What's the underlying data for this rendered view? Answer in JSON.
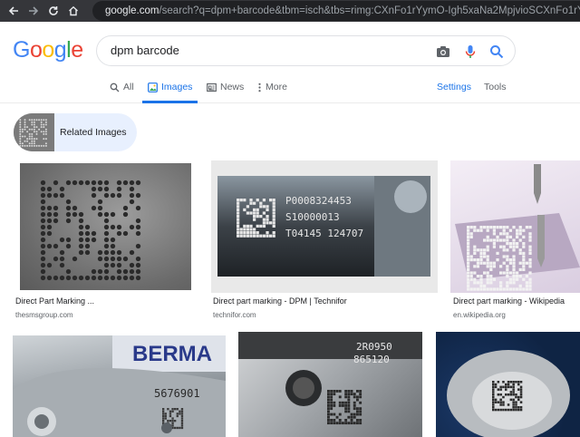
{
  "browser": {
    "url_host": "google.com",
    "url_rest": "/search?q=dpm+barcode&tbm=isch&tbs=rimg:CXnFo1rYymO-Igh5xaNa2MpjvioSCXnFo1rYymO-EVQF"
  },
  "logo": {
    "letters": [
      "G",
      "o",
      "o",
      "g",
      "l",
      "e"
    ],
    "colors": [
      "#4285f4",
      "#ea4335",
      "#fbbc05",
      "#4285f4",
      "#34a853",
      "#ea4335"
    ]
  },
  "search": {
    "query": "dpm barcode"
  },
  "tabs": {
    "all": "All",
    "images": "Images",
    "news": "News",
    "more": "More",
    "settings": "Settings",
    "tools": "Tools"
  },
  "related": {
    "label": "Related Images"
  },
  "results": [
    {
      "caption": "Direct Part Marking ...",
      "domain": "thesmsgroup.com"
    },
    {
      "caption": "Direct part marking - DPM | Technifor",
      "domain": "technifor.com"
    },
    {
      "caption": "Direct part marking - Wikipedia",
      "domain": "en.wikipedia.org"
    }
  ],
  "image_text": {
    "technifor_lines": [
      "P0008324453",
      "S10000013",
      "T04145  124707"
    ],
    "berma_brand": "BERMA",
    "berma_number": "5676901",
    "part5_lines": [
      "2R0950",
      "865120"
    ]
  }
}
